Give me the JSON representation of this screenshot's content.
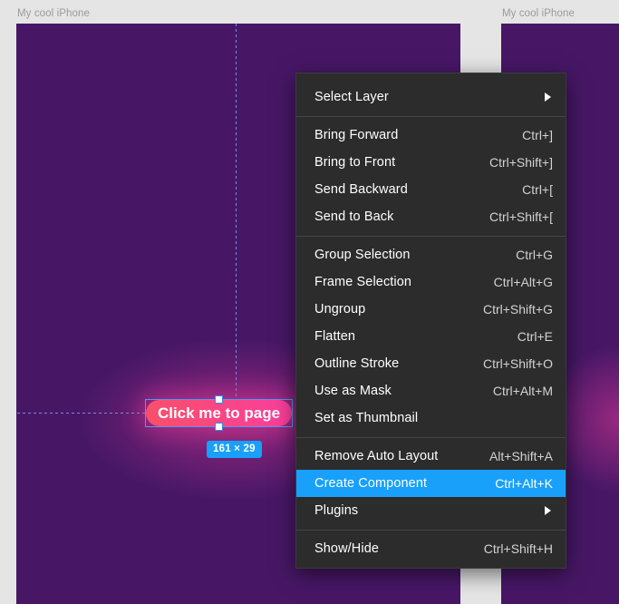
{
  "canvas": {
    "frames": [
      {
        "label": "My cool iPhone"
      },
      {
        "label": "My cool iPhone"
      }
    ],
    "selection": {
      "button_label": "Click me to page",
      "size_badge": "161 × 29",
      "width": "161",
      "height": "29"
    },
    "colors": {
      "frame_background": "#471766",
      "button_gradient_start": "#f8506a",
      "button_gradient_end": "#fa3e9e",
      "selection_blue": "#18a0fb",
      "guide_blue": "#6d8fe8",
      "canvas_background": "#e5e5e5"
    }
  },
  "context_menu": {
    "groups": [
      {
        "items": [
          {
            "label": "Select Layer",
            "shortcut": "",
            "submenu": true,
            "selected": false
          }
        ]
      },
      {
        "items": [
          {
            "label": "Bring Forward",
            "shortcut": "Ctrl+]",
            "submenu": false,
            "selected": false
          },
          {
            "label": "Bring to Front",
            "shortcut": "Ctrl+Shift+]",
            "submenu": false,
            "selected": false
          },
          {
            "label": "Send Backward",
            "shortcut": "Ctrl+[",
            "submenu": false,
            "selected": false
          },
          {
            "label": "Send to Back",
            "shortcut": "Ctrl+Shift+[",
            "submenu": false,
            "selected": false
          }
        ]
      },
      {
        "items": [
          {
            "label": "Group Selection",
            "shortcut": "Ctrl+G",
            "submenu": false,
            "selected": false
          },
          {
            "label": "Frame Selection",
            "shortcut": "Ctrl+Alt+G",
            "submenu": false,
            "selected": false
          },
          {
            "label": "Ungroup",
            "shortcut": "Ctrl+Shift+G",
            "submenu": false,
            "selected": false
          },
          {
            "label": "Flatten",
            "shortcut": "Ctrl+E",
            "submenu": false,
            "selected": false
          },
          {
            "label": "Outline Stroke",
            "shortcut": "Ctrl+Shift+O",
            "submenu": false,
            "selected": false
          },
          {
            "label": "Use as Mask",
            "shortcut": "Ctrl+Alt+M",
            "submenu": false,
            "selected": false
          },
          {
            "label": "Set as Thumbnail",
            "shortcut": "",
            "submenu": false,
            "selected": false
          }
        ]
      },
      {
        "items": [
          {
            "label": "Remove Auto Layout",
            "shortcut": "Alt+Shift+A",
            "submenu": false,
            "selected": false
          },
          {
            "label": "Create Component",
            "shortcut": "Ctrl+Alt+K",
            "submenu": false,
            "selected": true
          },
          {
            "label": "Plugins",
            "shortcut": "",
            "submenu": true,
            "selected": false
          }
        ]
      },
      {
        "items": [
          {
            "label": "Show/Hide",
            "shortcut": "Ctrl+Shift+H",
            "submenu": false,
            "selected": false
          }
        ]
      }
    ]
  }
}
